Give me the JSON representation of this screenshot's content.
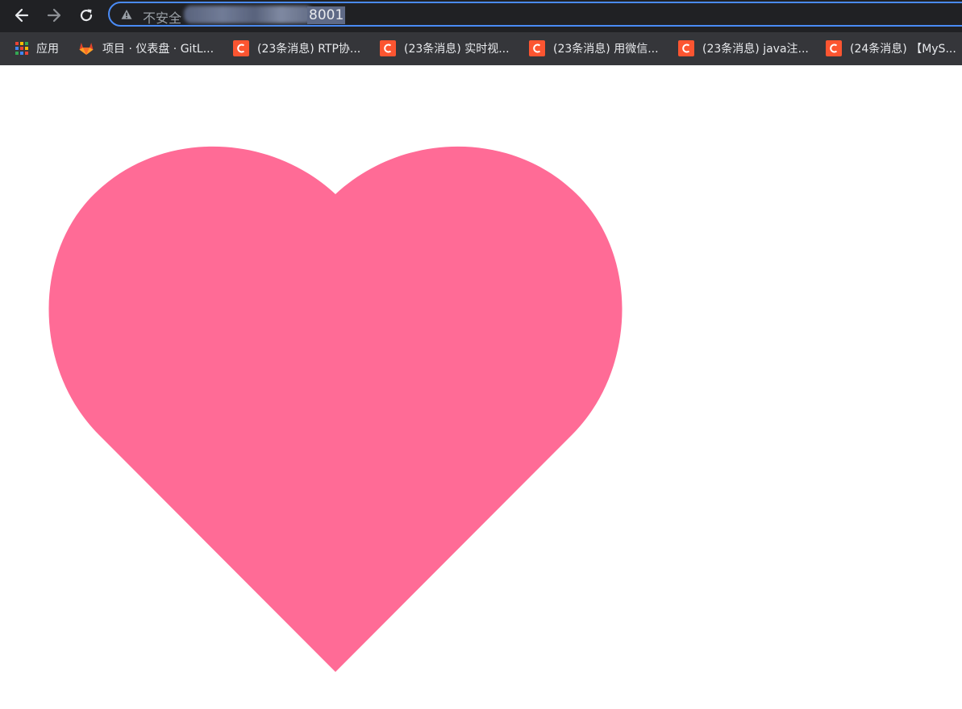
{
  "toolbar": {
    "address": {
      "security_label": "不安全",
      "visible_port": "8001"
    }
  },
  "bookmarks": [
    {
      "label": "应用",
      "icon": "apps-grid-icon"
    },
    {
      "label": "项目 · 仪表盘 · GitL...",
      "icon": "gitlab-icon"
    },
    {
      "label": "(23条消息) RTP协...",
      "icon": "csdn-icon"
    },
    {
      "label": "(23条消息) 实时视...",
      "icon": "csdn-icon"
    },
    {
      "label": "(23条消息) 用微信...",
      "icon": "csdn-icon"
    },
    {
      "label": "(23条消息) java注...",
      "icon": "csdn-icon"
    },
    {
      "label": "(24条消息) 【MyS...",
      "icon": "csdn-icon"
    }
  ],
  "colors": {
    "heart": "#ff6b96",
    "toolbar_bg": "#202124",
    "bookmarks_bg": "#35363a",
    "focus_ring": "#4a8bf5",
    "csdn_brand": "#fc5531"
  },
  "content": {
    "shape": "heart-icon"
  }
}
